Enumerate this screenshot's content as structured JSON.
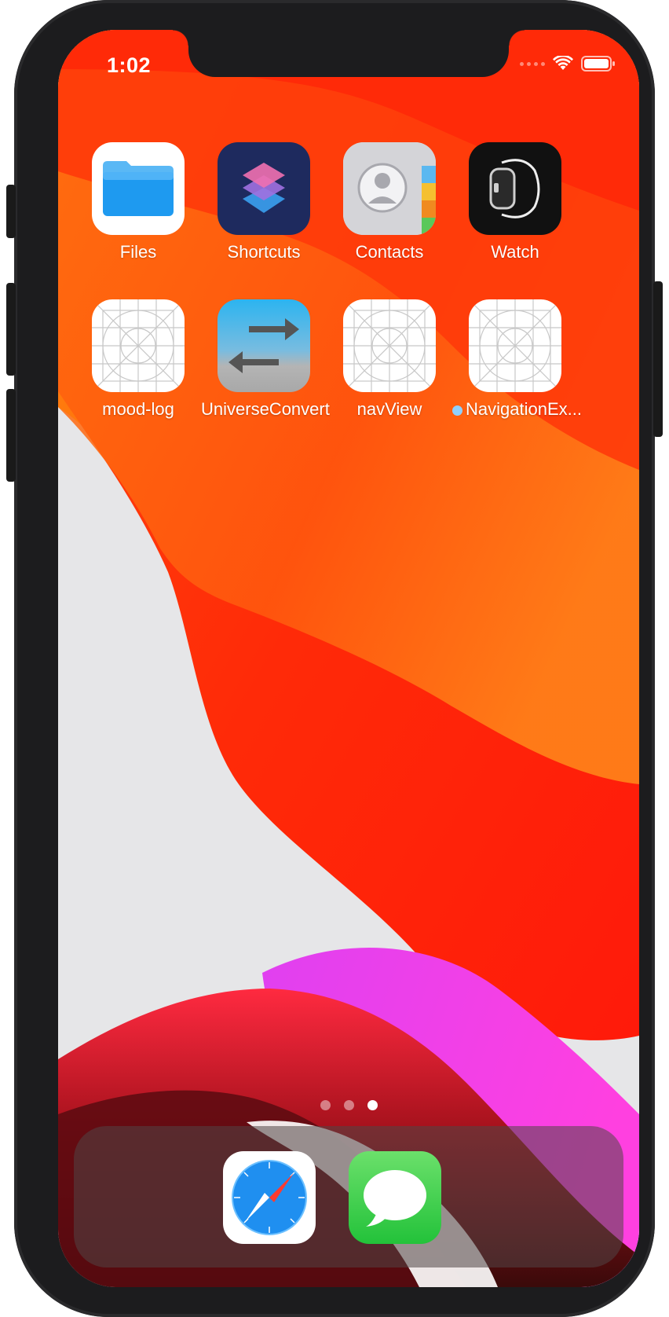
{
  "status_bar": {
    "time": "1:02",
    "signal_icon": "cellular-dots-icon",
    "wifi_icon": "wifi-icon",
    "battery_icon": "battery-icon"
  },
  "home_screen": {
    "apps": [
      {
        "label": "Files",
        "icon": "files-folder-icon"
      },
      {
        "label": "Shortcuts",
        "icon": "shortcuts-icon"
      },
      {
        "label": "Contacts",
        "icon": "contacts-icon"
      },
      {
        "label": "Watch",
        "icon": "watch-icon"
      },
      {
        "label": "mood-log",
        "icon": "placeholder-grid-icon"
      },
      {
        "label": "UniverseConvert",
        "icon": "arrows-swap-icon"
      },
      {
        "label": "navView",
        "icon": "placeholder-grid-icon"
      },
      {
        "label": "NavigationEx...",
        "icon": "placeholder-grid-icon",
        "new_install_dot": true
      }
    ],
    "page_indicator": {
      "pages": 3,
      "current": 3
    }
  },
  "dock": {
    "apps": [
      {
        "name": "Safari",
        "icon": "safari-compass-icon"
      },
      {
        "name": "Messages",
        "icon": "messages-bubble-icon"
      }
    ]
  },
  "colors": {
    "wallpaper_red": "#ff2f0a",
    "wallpaper_orange": "#ff5a12",
    "wallpaper_yellow": "#ffd000",
    "wallpaper_magenta": "#f040f0",
    "wallpaper_background": "#e6e6e8",
    "new_app_dot": "#8fd0ff"
  }
}
